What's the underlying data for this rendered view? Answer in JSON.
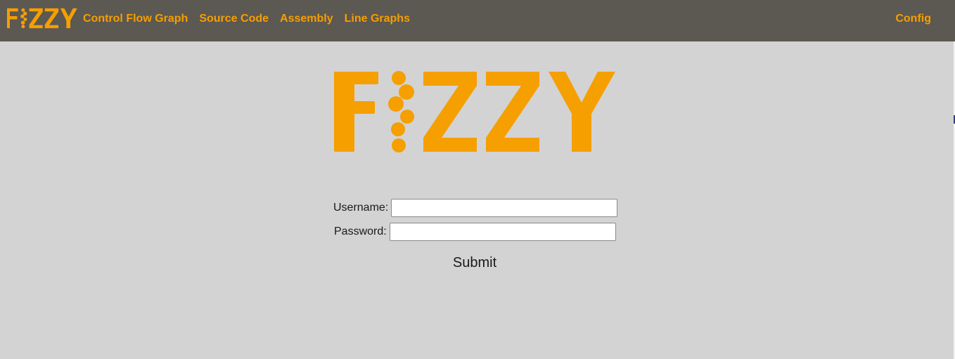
{
  "brand": {
    "logo_text": "FIZZY",
    "logo_color": "#f59f00",
    "navbar_bg": "#5c5852",
    "page_bg": "#d3d3d3"
  },
  "nav": {
    "links": [
      {
        "label": "Control Flow Graph"
      },
      {
        "label": "Source Code"
      },
      {
        "label": "Assembly"
      },
      {
        "label": "Line Graphs"
      }
    ],
    "config_label": "Config"
  },
  "login": {
    "username_label": "Username:",
    "username_value": "",
    "password_label": "Password:",
    "password_value": "",
    "submit_label": "Submit"
  }
}
